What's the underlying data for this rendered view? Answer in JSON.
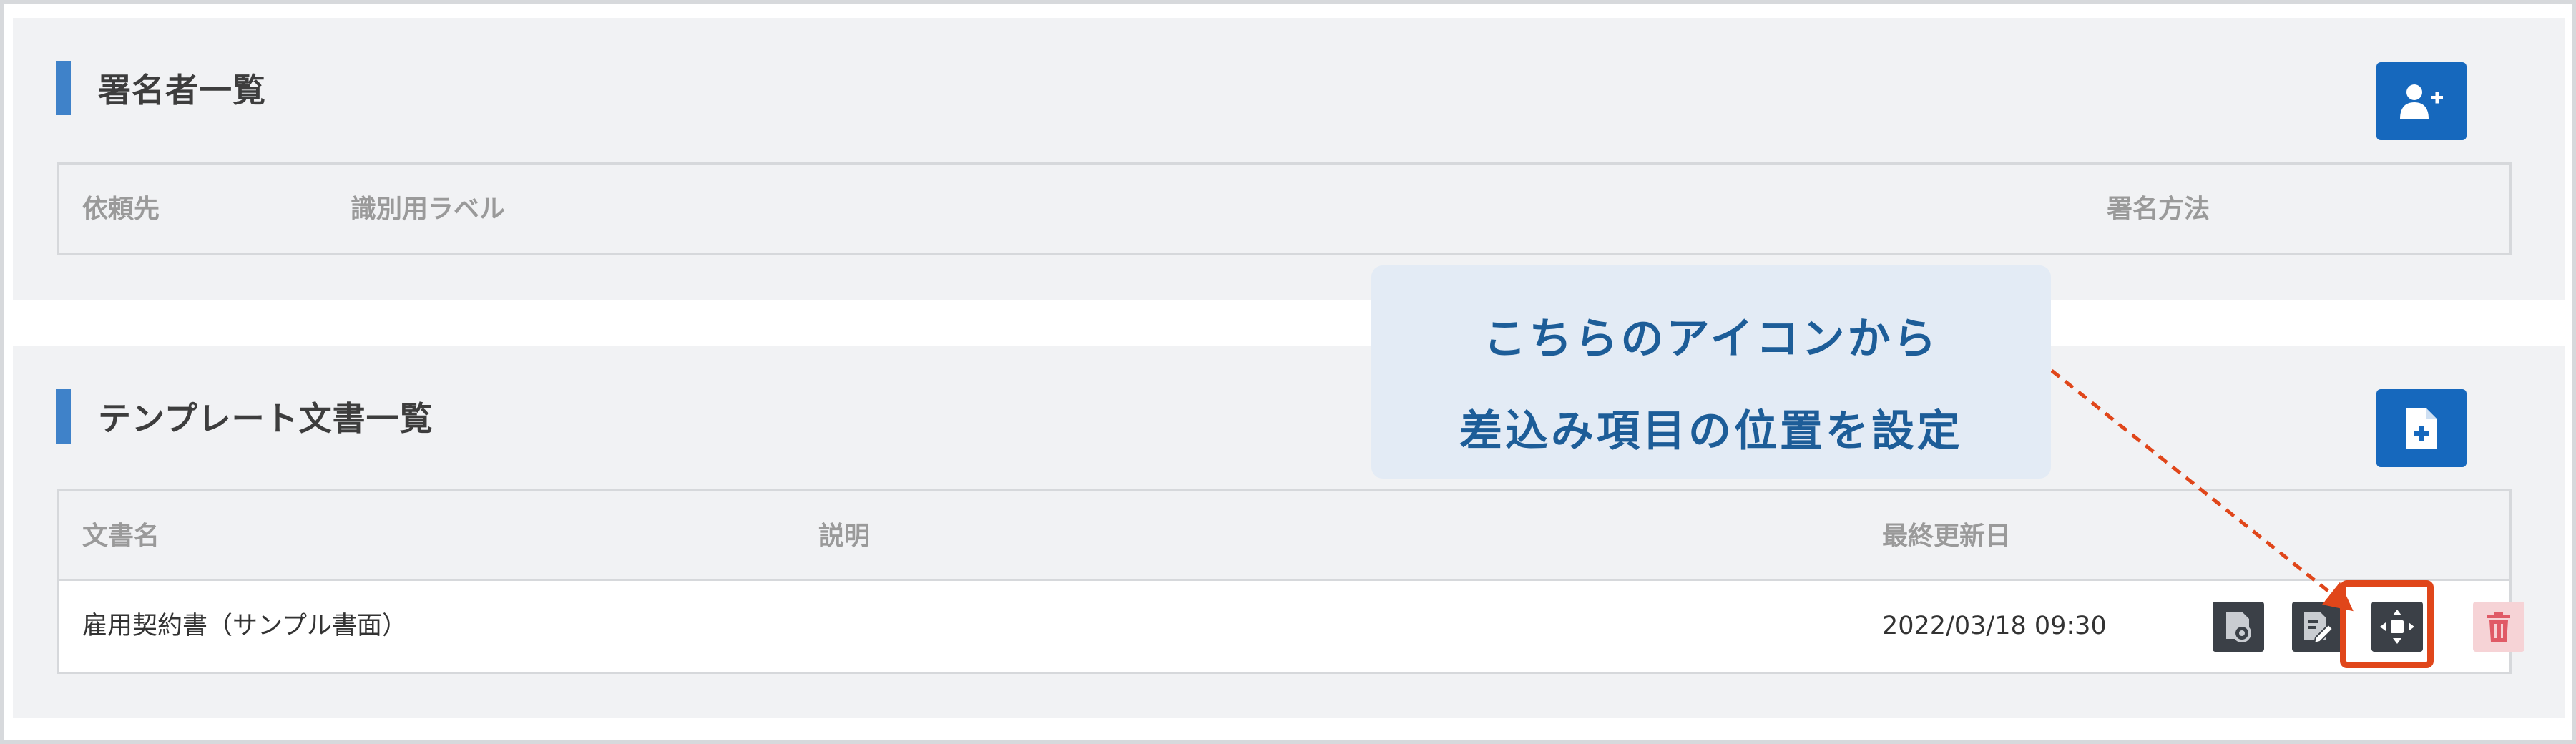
{
  "signers": {
    "title": "署名者一覧",
    "add_button_icon": "add-person-icon",
    "columns": [
      "依頼先",
      "識別用ラベル",
      "署名方法"
    ]
  },
  "templates": {
    "title": "テンプレート文書一覧",
    "add_button_icon": "add-document-icon",
    "columns": [
      "文書名",
      "説明",
      "最終更新日"
    ],
    "rows": [
      {
        "name": "雇用契約書（サンプル書面）",
        "description": "",
        "updated": "2022/03/18 09:30",
        "actions": [
          "view-document-icon",
          "edit-document-icon",
          "move-fields-icon",
          "trash-icon"
        ]
      }
    ]
  },
  "callout": {
    "line1": "こちらのアイコンから",
    "line2": "差込み項目の位置を設定"
  },
  "colors": {
    "accent": "#1668bd",
    "title_bar": "#3f82c9",
    "highlight": "#e0461a",
    "callout_bg": "#e3ebf5",
    "callout_text": "#1d5d98",
    "delete_bg": "#f6d3d6",
    "delete_icon": "#e05a66"
  }
}
